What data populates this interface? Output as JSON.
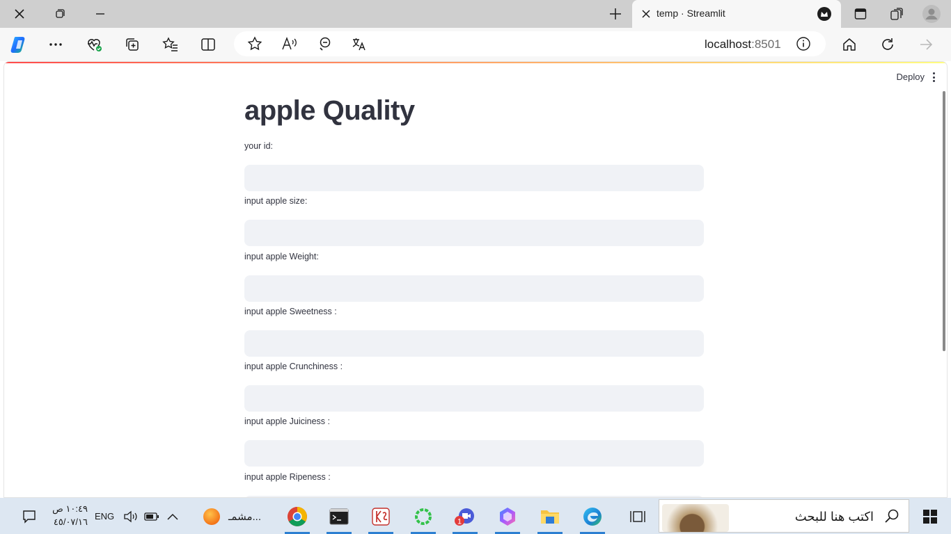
{
  "browser": {
    "tab_title": "temp · Streamlit",
    "url_host": "localhost",
    "url_port": ":8501"
  },
  "app": {
    "deploy_label": "Deploy",
    "title": "apple Quality",
    "fields": [
      {
        "label": "your id:",
        "value": ""
      },
      {
        "label": "input apple size:",
        "value": ""
      },
      {
        "label": "input apple Weight:",
        "value": ""
      },
      {
        "label": "input apple Sweetness :",
        "value": ""
      },
      {
        "label": "input apple Crunchiness :",
        "value": ""
      },
      {
        "label": "input apple Juiciness :",
        "value": ""
      },
      {
        "label": "input apple Ripeness :",
        "value": ""
      }
    ]
  },
  "taskbar": {
    "search_placeholder": "اكتب هنا للبحث",
    "time": "١٠:٤٩ ص",
    "date": "٤٥/٠٧/١٦",
    "language": "ENG",
    "tray_item_label": "مشمـ...",
    "notification_badge": "1"
  },
  "colors": {
    "accent": "#ff4b4b",
    "input_bg": "#f0f2f6",
    "text": "#31333f",
    "taskbar_bg": "#dde7f2"
  }
}
